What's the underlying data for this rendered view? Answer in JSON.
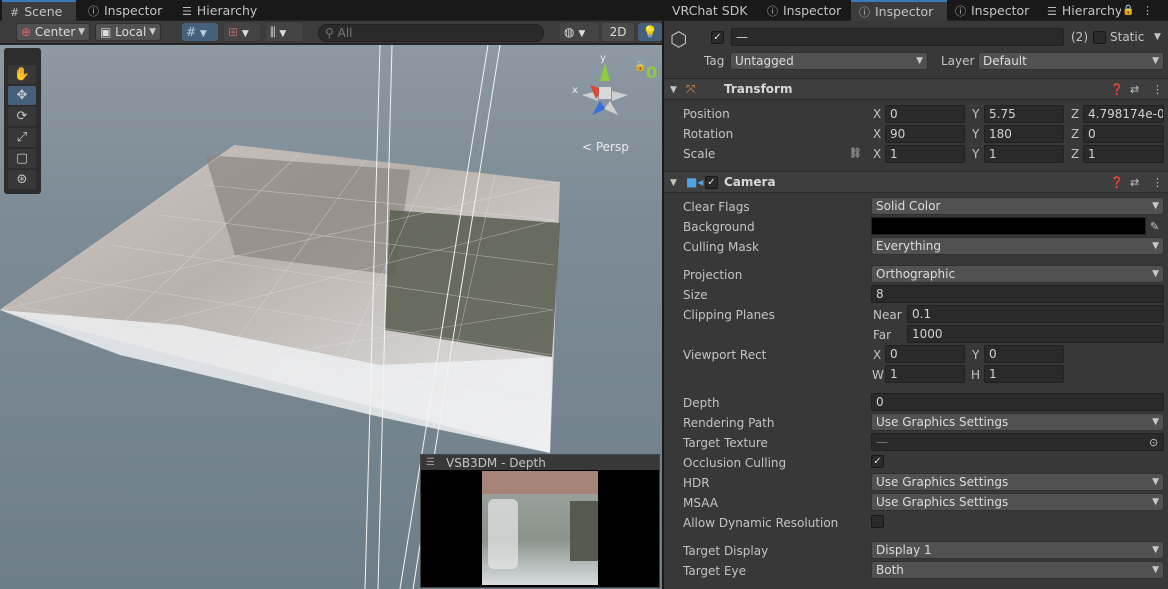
{
  "scene_tabs": [
    {
      "label": "Scene",
      "icon": "grid-icon"
    },
    {
      "label": "Inspector",
      "icon": "info-icon"
    },
    {
      "label": "Hierarchy",
      "icon": "list-icon"
    }
  ],
  "right_tabs": [
    {
      "label": "VRChat SDK"
    },
    {
      "label": "Inspector",
      "icon": "info-icon"
    },
    {
      "label": "Inspector",
      "icon": "info-icon"
    },
    {
      "label": "Inspector",
      "icon": "info-icon"
    },
    {
      "label": "Hierarchy",
      "icon": "list-icon"
    }
  ],
  "toolbar": {
    "pivot": "Center",
    "space": "Local",
    "search_placeholder": "All",
    "mode_2d": "2D"
  },
  "gizmo": {
    "x": "x",
    "y": "y",
    "persp": "< Persp",
    "counter": "0"
  },
  "preview": {
    "title": "VSB3DM - Depth"
  },
  "object": {
    "name": "—",
    "count": "(2)",
    "static_label": "Static",
    "tag_label": "Tag",
    "tag_value": "Untagged",
    "layer_label": "Layer",
    "layer_value": "Default"
  },
  "transform": {
    "title": "Transform",
    "position": {
      "label": "Position",
      "x": "0",
      "y": "5.75",
      "z": "4.798174e-0"
    },
    "rotation": {
      "label": "Rotation",
      "x": "90",
      "y": "180",
      "z": "0"
    },
    "scale": {
      "label": "Scale",
      "x": "1",
      "y": "1",
      "z": "1"
    },
    "axis": {
      "x": "X",
      "y": "Y",
      "z": "Z"
    }
  },
  "camera": {
    "title": "Camera",
    "clear_flags": {
      "label": "Clear Flags",
      "value": "Solid Color"
    },
    "background": {
      "label": "Background",
      "color": "#000000"
    },
    "culling_mask": {
      "label": "Culling Mask",
      "value": "Everything"
    },
    "projection": {
      "label": "Projection",
      "value": "Orthographic"
    },
    "size": {
      "label": "Size",
      "value": "8"
    },
    "clipping": {
      "label": "Clipping Planes",
      "near_label": "Near",
      "near": "0.1",
      "far_label": "Far",
      "far": "1000"
    },
    "viewport": {
      "label": "Viewport Rect",
      "x_label": "X",
      "x": "0",
      "y_label": "Y",
      "y": "0",
      "w_label": "W",
      "w": "1",
      "h_label": "H",
      "h": "1"
    },
    "depth": {
      "label": "Depth",
      "value": "0"
    },
    "rendering_path": {
      "label": "Rendering Path",
      "value": "Use Graphics Settings"
    },
    "target_texture": {
      "label": "Target Texture",
      "value": "—"
    },
    "occlusion_culling": {
      "label": "Occlusion Culling",
      "checked": true
    },
    "hdr": {
      "label": "HDR",
      "value": "Use Graphics Settings"
    },
    "msaa": {
      "label": "MSAA",
      "value": "Use Graphics Settings"
    },
    "dynamic_resolution": {
      "label": "Allow Dynamic Resolution",
      "checked": false
    },
    "target_display": {
      "label": "Target Display",
      "value": "Display 1"
    },
    "target_eye": {
      "label": "Target Eye",
      "value": "Both"
    }
  },
  "colors": {
    "accent": "#3a79bb",
    "panel": "#383838",
    "tab_bar": "#191919"
  }
}
